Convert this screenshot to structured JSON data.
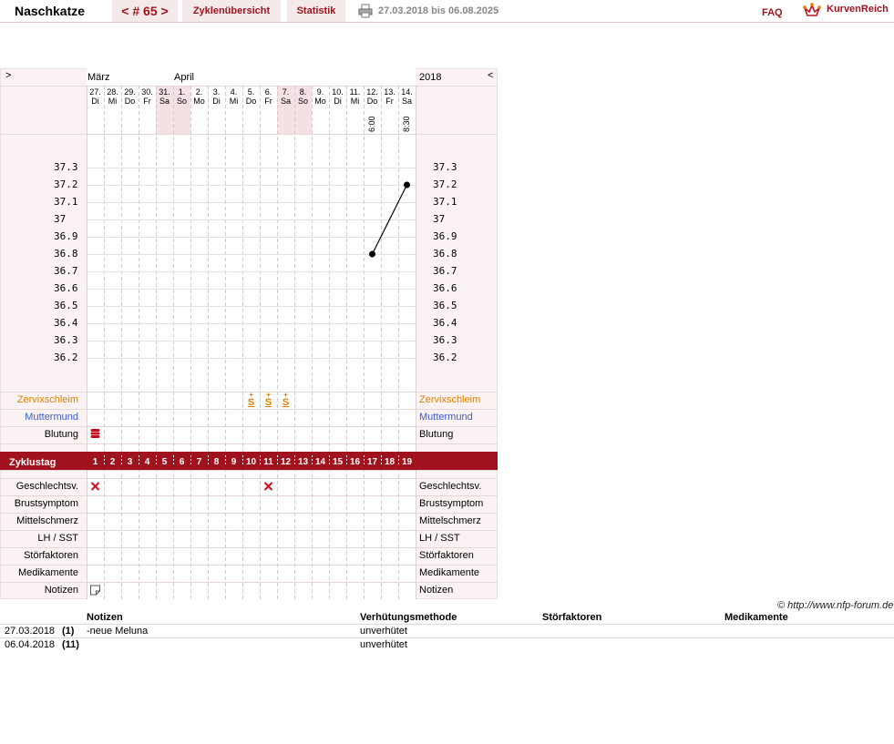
{
  "header": {
    "user_name": "Naschkatze",
    "cycle_nav": "< # 65 >",
    "tabs": [
      "Zyklenübersicht",
      "Statistik"
    ],
    "date_range": "27.03.2018 bis 06.08.2025",
    "faq": "FAQ",
    "logo_text": "KurvenReich",
    "icons": [
      "print-icon",
      "logo-crown-icon"
    ]
  },
  "chart": {
    "nav_prev": ">",
    "nav_next": "<",
    "months": [
      "März",
      "April"
    ],
    "year": "2018",
    "days": [
      {
        "num": "27.",
        "name": "Di"
      },
      {
        "num": "28.",
        "name": "Mi"
      },
      {
        "num": "29.",
        "name": "Do"
      },
      {
        "num": "30.",
        "name": "Fr"
      },
      {
        "num": "31.",
        "name": "Sa"
      },
      {
        "num": "1.",
        "name": "So"
      },
      {
        "num": "2.",
        "name": "Mo"
      },
      {
        "num": "3.",
        "name": "Di"
      },
      {
        "num": "4.",
        "name": "Mi"
      },
      {
        "num": "5.",
        "name": "Do"
      },
      {
        "num": "6.",
        "name": "Fr"
      },
      {
        "num": "7.",
        "name": "Sa"
      },
      {
        "num": "8.",
        "name": "So"
      },
      {
        "num": "9.",
        "name": "Mo"
      },
      {
        "num": "10.",
        "name": "Di"
      },
      {
        "num": "11.",
        "name": "Mi"
      },
      {
        "num": "12.",
        "name": "Do"
      },
      {
        "num": "13.",
        "name": "Fr"
      },
      {
        "num": "14.",
        "name": "Sa"
      }
    ],
    "weekend_days": [
      4,
      5,
      11,
      12
    ],
    "times": [
      {
        "day": 16,
        "time": "6:00"
      },
      {
        "day": 18,
        "time": "8:30"
      }
    ],
    "temp_labels": [
      "37.3",
      "37.2",
      "37.1",
      "37",
      "36.9",
      "36.8",
      "36.7",
      "36.6",
      "36.5",
      "36.4",
      "36.3",
      "36.2"
    ],
    "temp_range": [
      36.2,
      37.3
    ],
    "temperatures": [
      {
        "cycle_day": 17,
        "value": 36.8
      },
      {
        "cycle_day": 19,
        "value": 37.2
      }
    ],
    "rows": {
      "cervix": "Zervixschleim",
      "cervix_os": "Muttermund",
      "bleeding": "Blutung",
      "cycle_day": "Zyklustag",
      "intercourse": "Geschlechtsv.",
      "breast": "Brustsymptom",
      "midpain": "Mittelschmerz",
      "lh": "LH / SST",
      "disturbance": "Störfaktoren",
      "medication": "Medikamente",
      "notes": "Notizen"
    },
    "cervix_marks": [
      {
        "cycle_day": 10,
        "symbol": "S+"
      },
      {
        "cycle_day": 11,
        "symbol": "S+"
      },
      {
        "cycle_day": 12,
        "symbol": "S+"
      }
    ],
    "bleeding_marks": [
      {
        "cycle_day": 1,
        "icon": "bleeding-strong-icon"
      }
    ],
    "intercourse_marks": [
      {
        "cycle_day": 1,
        "icon": "x-mark-icon"
      },
      {
        "cycle_day": 11,
        "icon": "x-mark-icon"
      }
    ],
    "notes_marks": [
      {
        "cycle_day": 1,
        "icon": "note-icon"
      }
    ],
    "cycle_days": [
      "1",
      "2",
      "3",
      "4",
      "5",
      "6",
      "7",
      "8",
      "9",
      "10",
      "11",
      "12",
      "13",
      "14",
      "15",
      "16",
      "17",
      "18",
      "19"
    ],
    "colors": {
      "accent": "#a0121e",
      "cervix": "#e08000",
      "cervix_os": "#3a5ccc",
      "weekend": "#f3e1e3",
      "panel": "#fbf3f3"
    }
  },
  "footer": {
    "copyright": "© http://www.nfp-forum.de",
    "columns": [
      "Notizen",
      "Verhütungsmethode",
      "Störfaktoren",
      "Medikamente"
    ],
    "rows": [
      {
        "date": "27.03.2018",
        "day": "(1)",
        "note": "-neue Meluna",
        "method": "unverhütet"
      },
      {
        "date": "06.04.2018",
        "day": "(11)",
        "note": "",
        "method": "unverhütet"
      }
    ]
  }
}
